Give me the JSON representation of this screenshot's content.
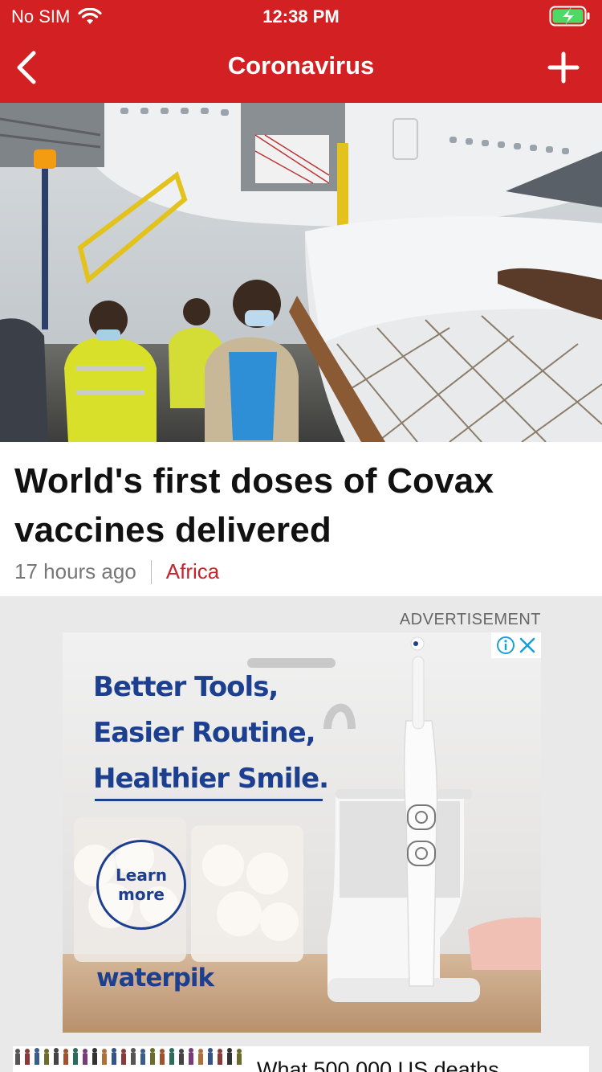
{
  "status_bar": {
    "carrier": "No SIM",
    "time": "12:38 PM"
  },
  "nav": {
    "title": "Coronavirus"
  },
  "article": {
    "headline": "World's first doses of Covax vaccines delivered",
    "age": "17 hours ago",
    "section": "Africa"
  },
  "ad": {
    "label": "ADVERTISEMENT",
    "lines": [
      "Better Tools,",
      "Easier Routine,",
      "Healthier Smile."
    ],
    "cta": [
      "Learn",
      "more"
    ],
    "brand": "waterpik",
    "product_brand": "waterpik"
  },
  "next_story": {
    "title": "What 500,000 US deaths"
  },
  "colors": {
    "brand_red": "#d32123",
    "ad_blue": "#1c3f8f",
    "section_red": "#c8232b"
  },
  "icons": [
    "wifi-icon",
    "battery-charging-icon",
    "back-chevron-icon",
    "add-icon",
    "adchoices-info-icon",
    "ad-close-icon"
  ]
}
